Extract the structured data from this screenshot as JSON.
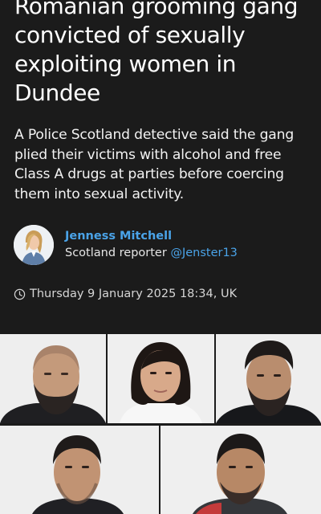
{
  "article": {
    "headline": "Romanian grooming gang convicted of sexually exploiting women in Dundee",
    "standfirst": "A Police Scotland detective said the gang plied their victims with alcohol and free Class A drugs at parties before coercing them into sexual activity."
  },
  "author": {
    "name": "Jenness Mitchell",
    "role": "Scotland reporter",
    "handle": "@Jenster13"
  },
  "timestamp": {
    "icon": "clock-icon",
    "text": "Thursday 9 January 2025 18:34, UK"
  },
  "photos": [
    {
      "name": "mugshot-1",
      "description_icon": "bald-bearded-man"
    },
    {
      "name": "mugshot-2",
      "description_icon": "woman-dark-hair"
    },
    {
      "name": "mugshot-3",
      "description_icon": "man-dark-hair-beard"
    },
    {
      "name": "mugshot-4",
      "description_icon": "man-short-hair"
    },
    {
      "name": "mugshot-5",
      "description_icon": "man-stubble"
    }
  ],
  "colors": {
    "background": "#1b1b1b",
    "link": "#4aa3e8",
    "text": "#ffffff",
    "photo_background": "#ededed"
  }
}
